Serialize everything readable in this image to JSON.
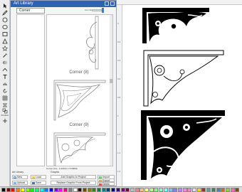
{
  "window": {
    "title": "Art Library",
    "category": "Corner",
    "size_label": "Icon Size:"
  },
  "items": [
    {
      "label": "Corner (8)"
    },
    {
      "label": "Corner (9)"
    }
  ],
  "info_text": "Corner (12) - 6.4010in x 5.9060in",
  "groups": {
    "art_library": "Art Library",
    "graphic": "Graphic"
  },
  "buttons": {
    "new": "New",
    "load": "Load",
    "upload": "Upload",
    "save": "Save",
    "add_graphic": "Add Graphic to Project",
    "import": "Import",
    "export": "Export",
    "replace": "Replace Graphic From Project",
    "delete": "Delete"
  },
  "tool_strip": {
    "label": "Position"
  },
  "ruler": {
    "marks": [
      "0",
      "0.2",
      "0.4",
      "0.6",
      "0.8",
      "1",
      "1.2",
      "1.4",
      "1.6"
    ]
  },
  "palette": {
    "colors": [
      "#000000",
      "#7f0000",
      "#ff0000",
      "#ff7f00",
      "#ffff00",
      "#7fff00",
      "#00ff00",
      "#00ff7f",
      "#00ffff",
      "#007fff",
      "#0000ff",
      "#7f00ff",
      "#ff00ff",
      "#ff007f",
      "#7f7f7f",
      "#ffffff",
      "#400000",
      "#804000",
      "#808000",
      "#408000",
      "#008040",
      "#008080",
      "#004080",
      "#000080",
      "#400080",
      "#800080",
      "#800040",
      "#c0c0c0",
      "#ff8080",
      "#ffc080",
      "#ffff80",
      "#c0ff80",
      "#80ff80",
      "#80ffc0",
      "#80ffff",
      "#80c0ff",
      "#8080ff",
      "#c080ff",
      "#ff80ff",
      "#ff80c0",
      "#e0e0e0",
      "#ffd700",
      "#a52a2a",
      "#5f9ea0",
      "#2e8b57",
      "#4682b4",
      "#d2691e",
      "#9acd32",
      "#ff69b4",
      "#8b4513"
    ]
  }
}
